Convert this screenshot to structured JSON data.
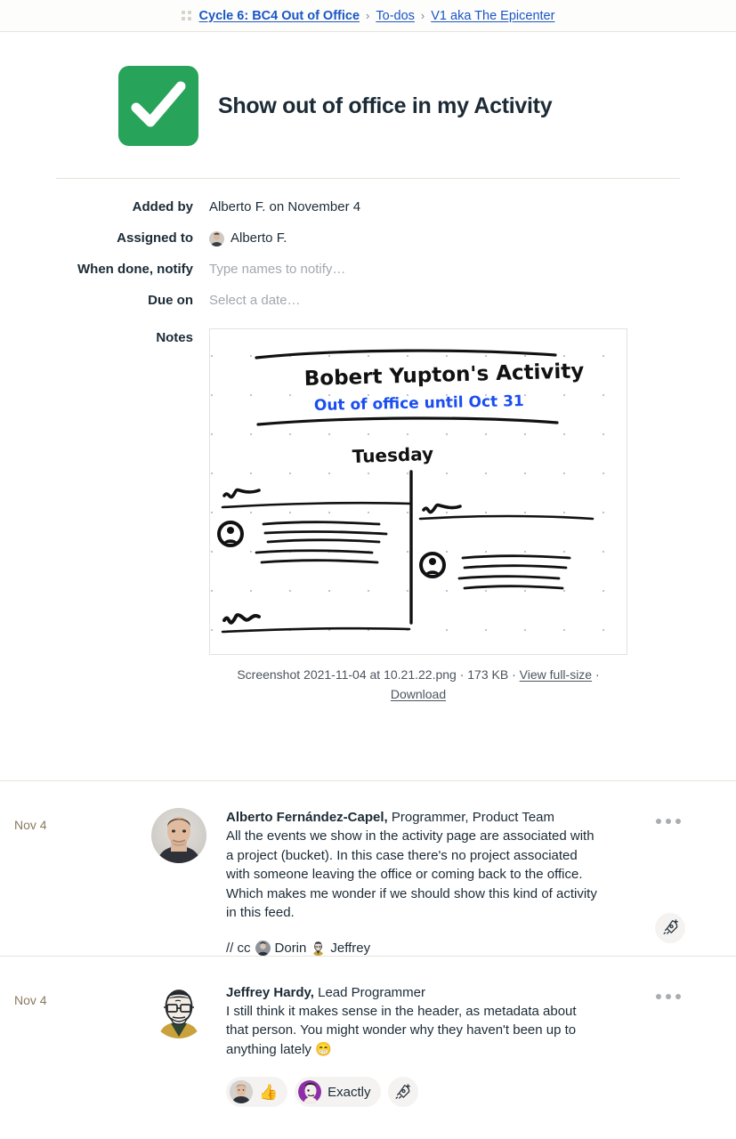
{
  "breadcrumb": {
    "grid_icon": "grid-icon",
    "items": [
      {
        "label": "Cycle 6: BC4 Out of Office",
        "strong": true
      },
      {
        "label": "To-dos",
        "strong": false
      },
      {
        "label": "V1 aka The Epicenter",
        "strong": false
      }
    ],
    "separator": "›"
  },
  "todo": {
    "title": "Show out of office in my Activity",
    "completed": true,
    "check_color": "#27a35a"
  },
  "meta": {
    "added_by_label": "Added by",
    "added_by_value": "Alberto F. on November 4",
    "assigned_to_label": "Assigned to",
    "assigned_to_value": "Alberto F.",
    "notify_label": "When done, notify",
    "notify_placeholder": "Type names to notify…",
    "due_label": "Due on",
    "due_placeholder": "Select a date…",
    "notes_label": "Notes"
  },
  "sketch": {
    "heading": "Bobert Yupton's Activity",
    "subheading": "Out of office until Oct 31",
    "subheading_color": "#1a4ef0",
    "day_label": "Tuesday"
  },
  "attachment": {
    "filename": "Screenshot 2021-11-04 at 10.21.22.png",
    "separator": "·",
    "size": "173 KB",
    "view_link": "View full-size",
    "download_link": "Download"
  },
  "comments": [
    {
      "date": "Nov 4",
      "author": "Alberto Fernández-Capel,",
      "role": " Programmer, Product Team",
      "text": "All the events we show in the activity page are associated with a project (bucket). In this case there's no project associated with someone leaving the office or coming back to the office. Which makes me wonder if we should show this kind of activity in this feed.",
      "cc_prefix": "// cc",
      "cc_names": [
        "Dorin",
        "Jeffrey"
      ],
      "boost_icon": "rocket-plus-icon",
      "menu_icon": "more-options-icon"
    },
    {
      "date": "Nov 4",
      "author": "Jeffrey Hardy,",
      "role": " Lead Programmer",
      "text": "I still think it makes sense in the header, as metadata about that person. You might wonder why they haven't been up to anything lately 😁",
      "menu_icon": "more-options-icon",
      "reactions": [
        {
          "type": "emoji",
          "emoji": "👍",
          "avatar": "alberto"
        },
        {
          "type": "text",
          "label": "Exactly",
          "avatar": "purple"
        }
      ],
      "boost_icon": "rocket-plus-icon"
    }
  ]
}
